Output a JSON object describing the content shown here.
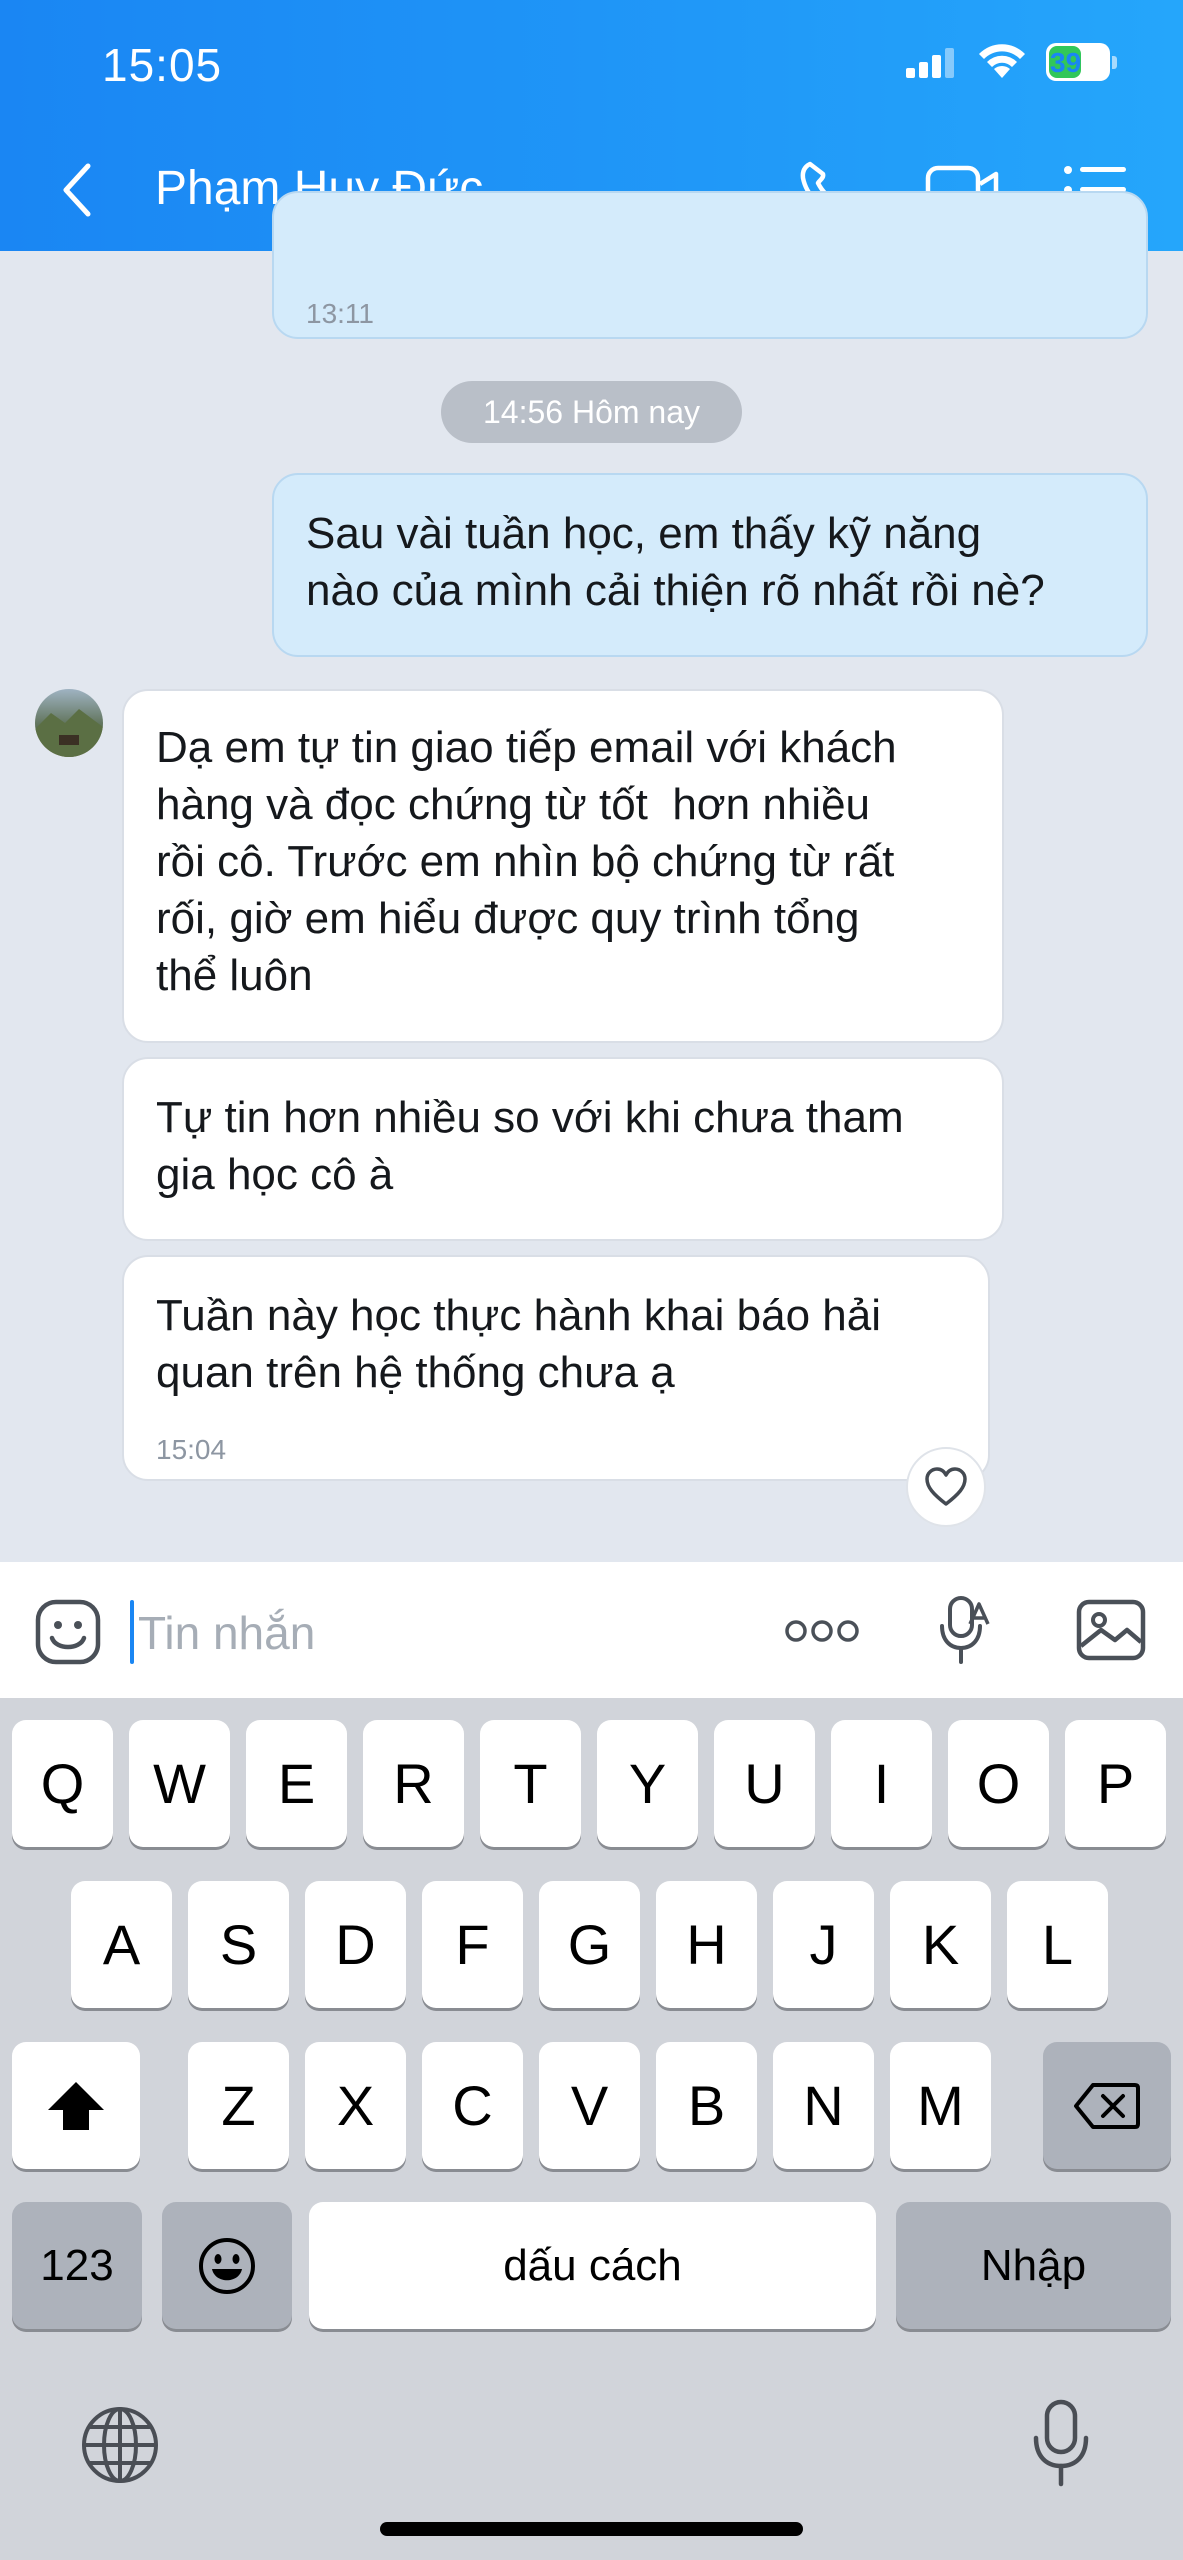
{
  "status_bar": {
    "time": "15:05",
    "battery": "39"
  },
  "header": {
    "contact_name": "Phạm Huy Đức"
  },
  "messages": {
    "top_out_time": "13:11",
    "date_divider": "14:56 Hôm nay",
    "out_1_line1": "Sau vài tuần học, em thấy kỹ năng",
    "out_1_line2": "nào của mình cải thiện rõ nhất rồi nè?",
    "in_1_line1": "Dạ em tự tin giao tiếp email với khách",
    "in_1_line2": "hàng và đọc chứng từ tốt  hơn nhiều",
    "in_1_line3": "rồi cô. Trước em nhìn bộ chứng từ rất",
    "in_1_line4": "rối, giờ em hiểu được quy trình tổng",
    "in_1_line5": "thể luôn",
    "in_2_line1": "Tự tin hơn nhiều so với khi chưa tham",
    "in_2_line2": "gia học cô à",
    "in_3_line1": "Tuần này học thực hành khai báo hải",
    "in_3_line2": "quan trên hệ thống chưa ạ",
    "in_3_time": "15:04"
  },
  "input_bar": {
    "placeholder": "Tin nhắn"
  },
  "keyboard": {
    "row1": [
      "Q",
      "W",
      "E",
      "R",
      "T",
      "Y",
      "U",
      "I",
      "O",
      "P"
    ],
    "row2": [
      "A",
      "S",
      "D",
      "F",
      "G",
      "H",
      "J",
      "K",
      "L"
    ],
    "row3": [
      "Z",
      "X",
      "C",
      "V",
      "B",
      "N",
      "M"
    ],
    "numbers_key": "123",
    "space_key": "dấu cách",
    "return_key": "Nhập"
  },
  "icons": {
    "back": "chevron-left-icon",
    "phone": "phone-icon",
    "video": "video-camera-icon",
    "menu": "list-menu-icon",
    "sticker": "sticker-face-icon",
    "more": "more-dots-icon",
    "voice": "voice-to-text-mic-icon",
    "image": "image-gallery-icon",
    "heart": "heart-icon",
    "shift": "shift-arrow-icon",
    "backspace": "backspace-icon",
    "emoji": "emoji-face-icon",
    "globe": "globe-icon",
    "dictation": "microphone-icon"
  },
  "colors": {
    "header_blue": "#1a86f3",
    "outgoing_bubble": "#d4ebfb",
    "incoming_bubble": "#ffffff",
    "chat_background": "#e2e7ef"
  }
}
